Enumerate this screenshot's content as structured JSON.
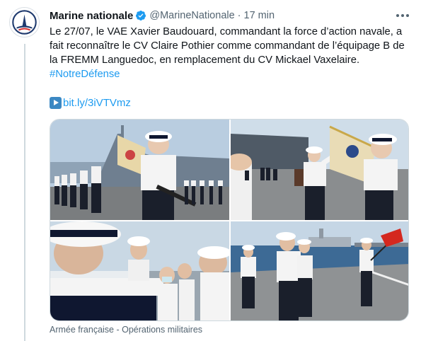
{
  "tweet": {
    "author": {
      "display_name": "Marine nationale",
      "handle": "@MarineNationale",
      "verified": true,
      "avatar_icon": "marine-nationale-logo-icon"
    },
    "separator": "·",
    "timestamp": "17 min",
    "text_body": "Le 27/07, le VAE Xavier Baudouard, commandant la force d’action navale, a fait reconnaître le CV Claire Pothier comme commandant de l’équipage B de la FREMM Languedoc, en remplacement du CV Mickael Vaxelaire.",
    "hashtag": "#NotreDéfense",
    "link_text": "bit.ly/3iVTVmz",
    "link_icon": "play-button-icon",
    "media_caption": "Armée française - Opérations militaires",
    "more_icon": "more-options-icon"
  },
  "colors": {
    "accent": "#1d9bf0",
    "text": "#0f1419",
    "secondary": "#536471",
    "border": "#cfd9de",
    "logo_navy": "#1f3a6e",
    "logo_red": "#d52b2b"
  }
}
